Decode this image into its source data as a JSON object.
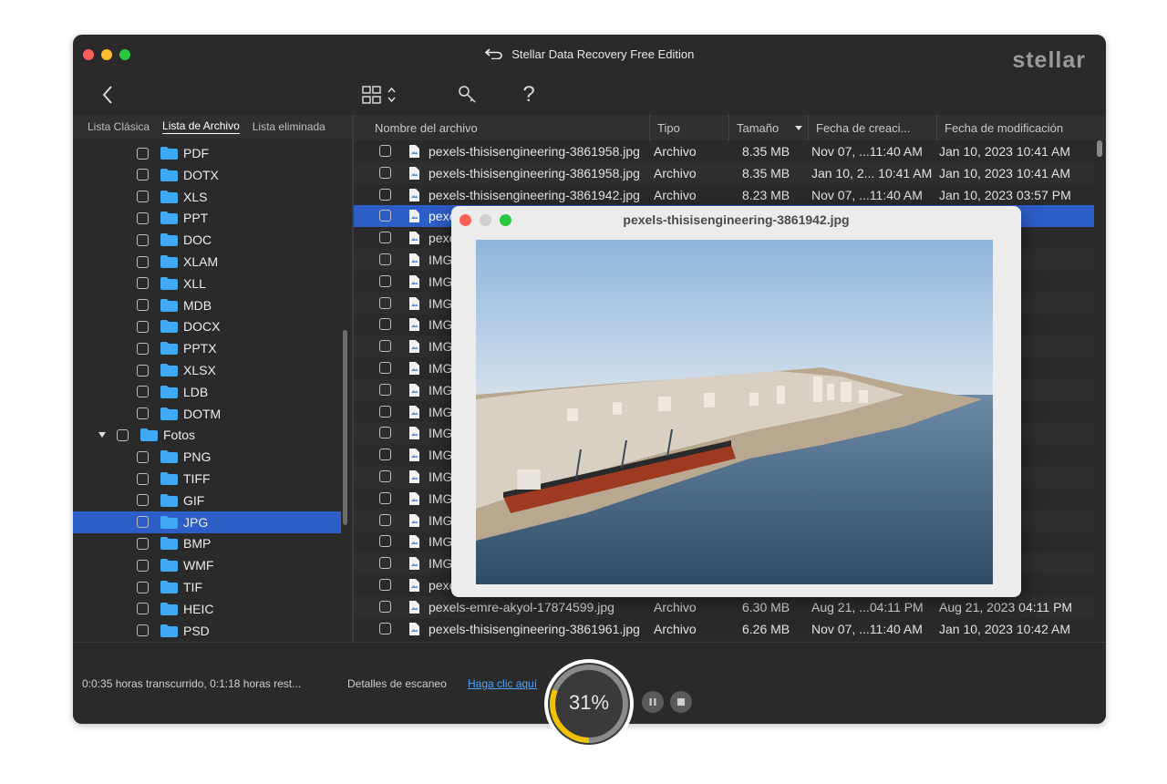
{
  "window": {
    "title": "Stellar Data Recovery Free Edition",
    "brand": "stellar"
  },
  "toolbar": {
    "back_icon": "chevron-left-icon",
    "view_icon": "grid-view-icon",
    "tools_icon": "wrench-icon",
    "help_label": "?"
  },
  "tabs": [
    "Lista Clásica",
    "Lista de Archivo",
    "Lista eliminada"
  ],
  "active_tab": "Lista de Archivo",
  "tree": [
    {
      "label": "PDF",
      "level": 2
    },
    {
      "label": "DOTX",
      "level": 2
    },
    {
      "label": "XLS",
      "level": 2
    },
    {
      "label": "PPT",
      "level": 2
    },
    {
      "label": "DOC",
      "level": 2
    },
    {
      "label": "XLAM",
      "level": 2
    },
    {
      "label": "XLL",
      "level": 2
    },
    {
      "label": "MDB",
      "level": 2
    },
    {
      "label": "DOCX",
      "level": 2
    },
    {
      "label": "PPTX",
      "level": 2
    },
    {
      "label": "XLSX",
      "level": 2
    },
    {
      "label": "LDB",
      "level": 2
    },
    {
      "label": "DOTM",
      "level": 2
    },
    {
      "label": "Fotos",
      "level": 1,
      "expanded": true
    },
    {
      "label": "PNG",
      "level": 2
    },
    {
      "label": "TIFF",
      "level": 2
    },
    {
      "label": "GIF",
      "level": 2
    },
    {
      "label": "JPG",
      "level": 2,
      "selected": true
    },
    {
      "label": "BMP",
      "level": 2
    },
    {
      "label": "WMF",
      "level": 2
    },
    {
      "label": "TIF",
      "level": 2
    },
    {
      "label": "HEIC",
      "level": 2
    },
    {
      "label": "PSD",
      "level": 2
    }
  ],
  "table": {
    "columns": [
      "Nombre del archivo",
      "Tipo",
      "Tamaño",
      "Fecha de creaci...",
      "Fecha de modificación"
    ],
    "rows": [
      [
        "pexels-thisisengineering-3861958.jpg",
        "Archivo",
        "8.35 MB",
        "Nov 07, ...11:40 AM",
        "Jan 10, 2023 10:41 AM"
      ],
      [
        "pexels-thisisengineering-3861958.jpg",
        "Archivo",
        "8.35 MB",
        "Jan 10, 2... 10:41 AM",
        "Jan 10, 2023 10:41 AM"
      ],
      [
        "pexels-thisisengineering-3861942.jpg",
        "Archivo",
        "8.23 MB",
        "Nov 07, ...11:40 AM",
        "Jan 10, 2023 03:57 PM"
      ],
      [
        "pexe",
        "",
        "",
        "",
        "3:57 PM"
      ],
      [
        "pexe",
        "",
        "",
        "",
        "1:41 PM"
      ],
      [
        "IMG",
        "",
        "",
        "",
        "5:36 PM"
      ],
      [
        "IMG",
        "",
        "",
        "",
        "5:36 PM"
      ],
      [
        "IMG",
        "",
        "",
        "",
        "5:36 PM"
      ],
      [
        "IMG",
        "",
        "",
        "",
        "5:36 PM"
      ],
      [
        "IMG",
        "",
        "",
        "",
        "5:36 PM"
      ],
      [
        "IMG",
        "",
        "",
        "",
        "5:36 PM"
      ],
      [
        "IMG",
        "",
        "",
        "",
        "5:36 PM"
      ],
      [
        "IMG",
        "",
        "",
        "",
        "5:39 PM"
      ],
      [
        "IMG",
        "",
        "",
        "",
        "5:39 PM"
      ],
      [
        "IMG",
        "",
        "",
        "",
        "5:39 PM"
      ],
      [
        "IMG",
        "",
        "",
        "",
        "5:39 PM"
      ],
      [
        "IMG",
        "",
        "",
        "",
        "5:39 PM"
      ],
      [
        "IMG",
        "",
        "",
        "",
        "5:39 PM"
      ],
      [
        "IMG",
        "",
        "",
        "",
        "5:39 PM"
      ],
      [
        "IMG",
        "",
        "",
        "",
        "5:36 PM"
      ],
      [
        "pexe",
        "",
        "",
        "",
        "4:11 PM"
      ],
      [
        "pexels-emre-akyol-17874599.jpg",
        "Archivo",
        "6.30 MB",
        "Aug 21, ...04:11 PM",
        "Aug 21, 2023 04:11 PM"
      ],
      [
        "pexels-thisisengineering-3861961.jpg",
        "Archivo",
        "6.26 MB",
        "Nov 07, ...11:40 AM",
        "Jan 10, 2023 10:42 AM"
      ]
    ],
    "selected_row": 3
  },
  "status": {
    "elapsed": "0:0:35 horas transcurrido, 0:1:18 horas rest...",
    "details_label": "Detalles de escaneo",
    "details_link": "Haga clic aquí",
    "progress_label": "31%",
    "progress": 0.31
  },
  "preview": {
    "title": "pexels-thisisengineering-3861942.jpg"
  },
  "colors": {
    "selection": "#2d5ec7",
    "folder": "#3fa9f5",
    "progress": "#f2c200",
    "link": "#4ea3ff"
  }
}
